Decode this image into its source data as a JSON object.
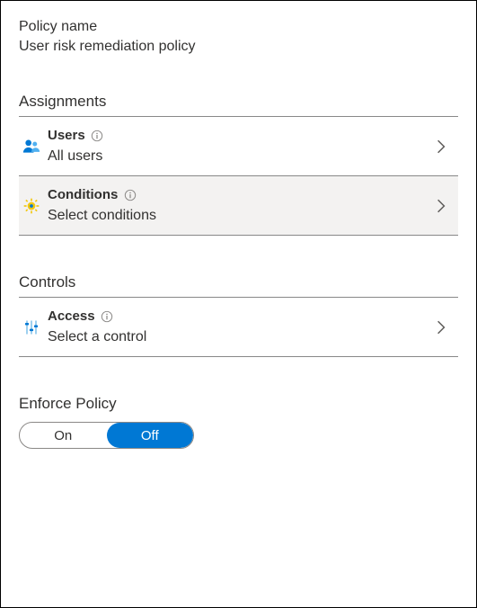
{
  "policy": {
    "label": "Policy name",
    "value": "User risk remediation policy"
  },
  "assignments": {
    "header": "Assignments",
    "items": [
      {
        "title": "Users",
        "sub": "All users",
        "iconName": "users-icon"
      },
      {
        "title": "Conditions",
        "sub": "Select conditions",
        "iconName": "gear-icon"
      }
    ]
  },
  "controls": {
    "header": "Controls",
    "items": [
      {
        "title": "Access",
        "sub": "Select a control",
        "iconName": "sliders-icon"
      }
    ]
  },
  "enforce": {
    "label": "Enforce Policy",
    "on": "On",
    "off": "Off",
    "value": "Off"
  },
  "colors": {
    "accent": "#0078d4"
  }
}
